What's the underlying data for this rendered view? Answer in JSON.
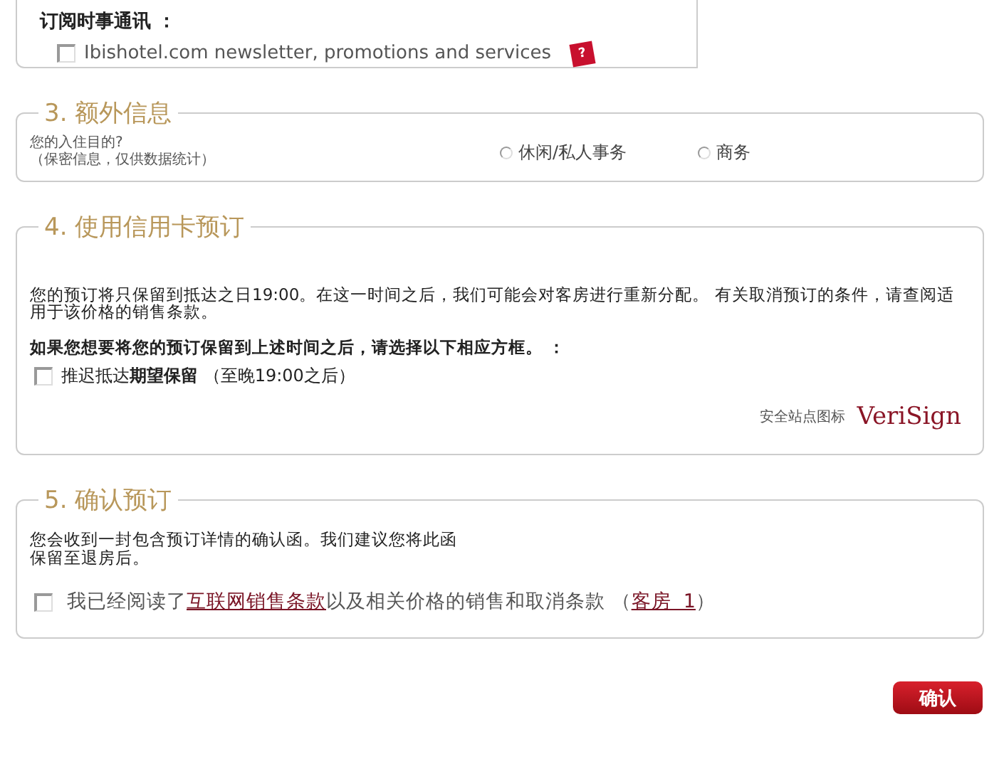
{
  "newsletter": {
    "heading": "订阅时事通讯 ：",
    "checkbox": {
      "label": "Ibishotel.com newsletter, promotions and services",
      "checked": false
    },
    "help": "?"
  },
  "extra_info": {
    "title": "3. 额外信息",
    "question": "您的入住目的?",
    "note": "（保密信息，仅供数据统计）",
    "options": [
      {
        "label": "休闲/私人事务",
        "selected": false
      },
      {
        "label": "商务",
        "selected": false
      }
    ]
  },
  "credit_card": {
    "title": "4. 使用信用卡预订",
    "paragraph": "您的预订将只保留到抵达之日19:00。在这一时间之后，我们可能会对客房进行重新分配。 有关取消预订的条件，请查阅适用于该价格的销售条款。",
    "prompt": "如果您想要将您的预订保留到上述时间之后，请选择以下相应方框。 ：",
    "checkbox": {
      "label": "推迟抵达**期望保留** （至晚19:00之后）",
      "checked": false
    },
    "secure_label": "安全站点图标",
    "logo": "VeriSign"
  },
  "confirmation": {
    "title": "5. 确认预订",
    "lines": [
      "您会收到一封包含预订详情的确认函。我们建议您将此函",
      "保留至退房后。"
    ],
    "agreement": {
      "checked": false,
      "before": "我已经阅读了",
      "link": "互联网销售条款",
      "after": "以及相关价格的销售和取消条款 （",
      "room_link": "客房  1",
      "end": "）"
    }
  },
  "button": "确认"
}
